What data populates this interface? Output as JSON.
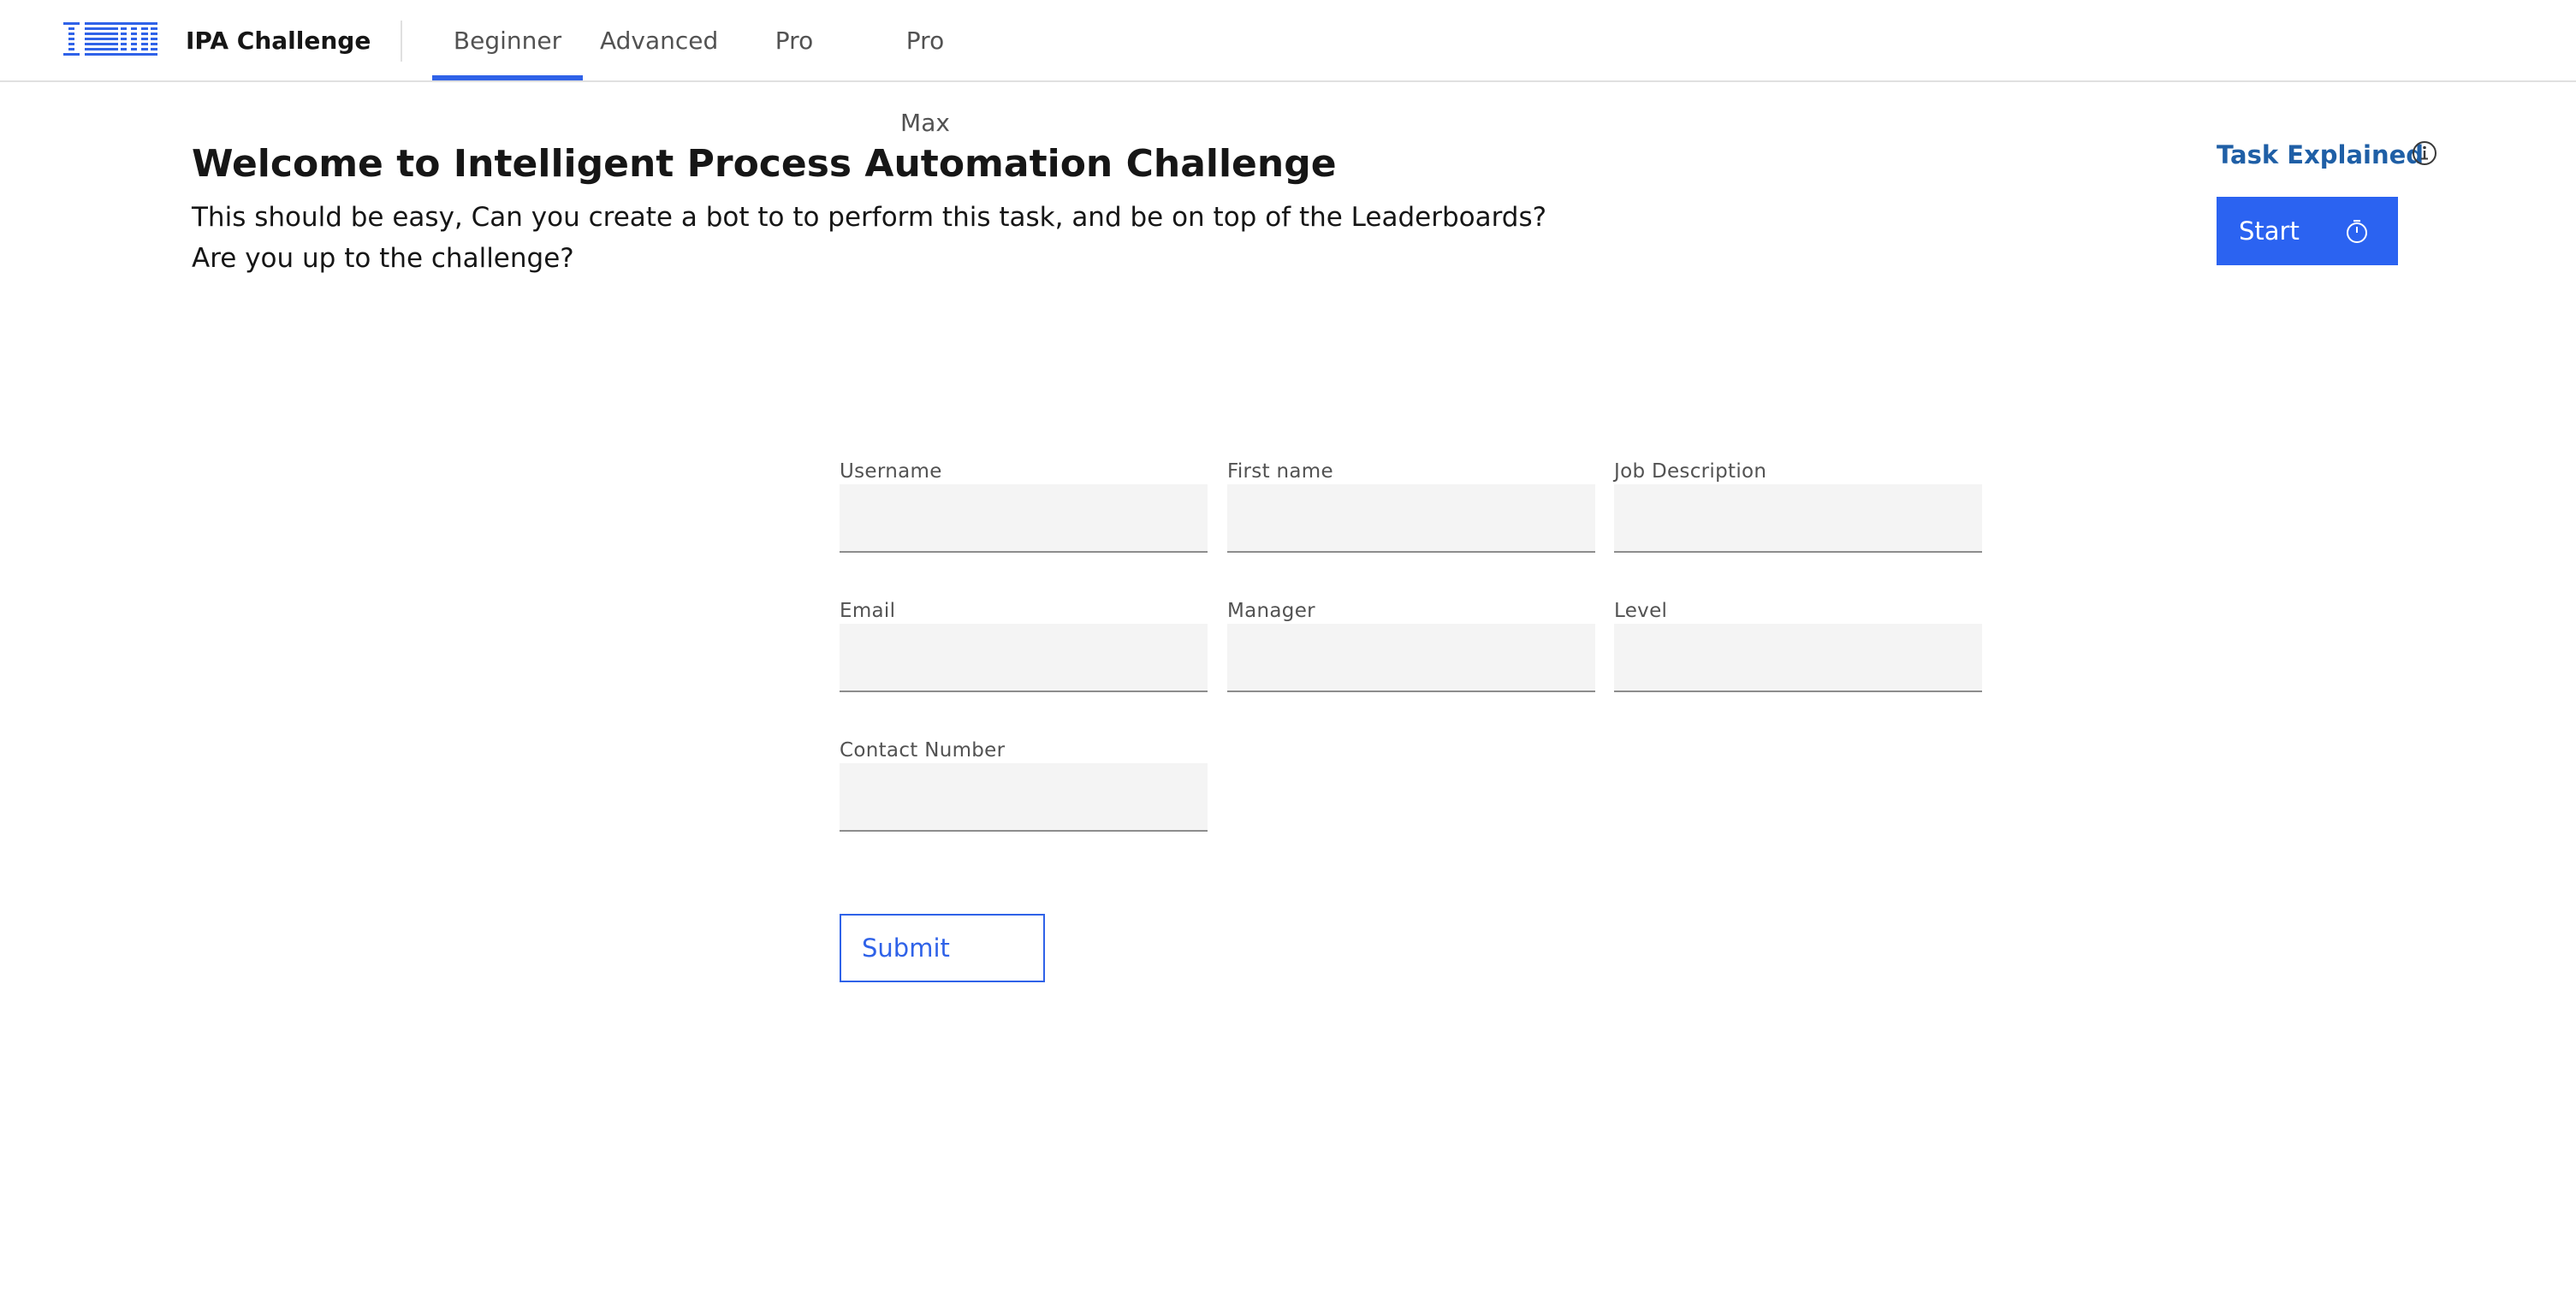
{
  "header": {
    "logo_text": "IBM",
    "app_name": "IPA Challenge",
    "tabs": [
      {
        "label": "Beginner",
        "active": true
      },
      {
        "label": "Advanced",
        "active": false
      },
      {
        "label": "Pro",
        "active": false
      },
      {
        "label": "Pro Max",
        "active": false
      }
    ]
  },
  "intro": {
    "title": "Welcome to Intelligent Process Automation Challenge",
    "line1": "This should be easy, Can you create a bot to to perform this task, and be on top of the Leaderboards?",
    "line2": "Are you up to the challenge?"
  },
  "side_panel": {
    "task_explained": "Task Explained",
    "info_icon": "info-icon",
    "start_label": "Start",
    "timer_icon": "timer-icon"
  },
  "form": {
    "fields": [
      {
        "label": "Username",
        "value": ""
      },
      {
        "label": "First name",
        "value": ""
      },
      {
        "label": "Job Description",
        "value": ""
      },
      {
        "label": "Email",
        "value": ""
      },
      {
        "label": "Manager",
        "value": ""
      },
      {
        "label": "Level",
        "value": ""
      },
      {
        "label": "Contact Number",
        "value": ""
      }
    ],
    "submit_label": "Submit"
  },
  "colors": {
    "accent": "#2b63f1",
    "link": "#1f5fa6",
    "field_bg": "#f4f4f4"
  }
}
